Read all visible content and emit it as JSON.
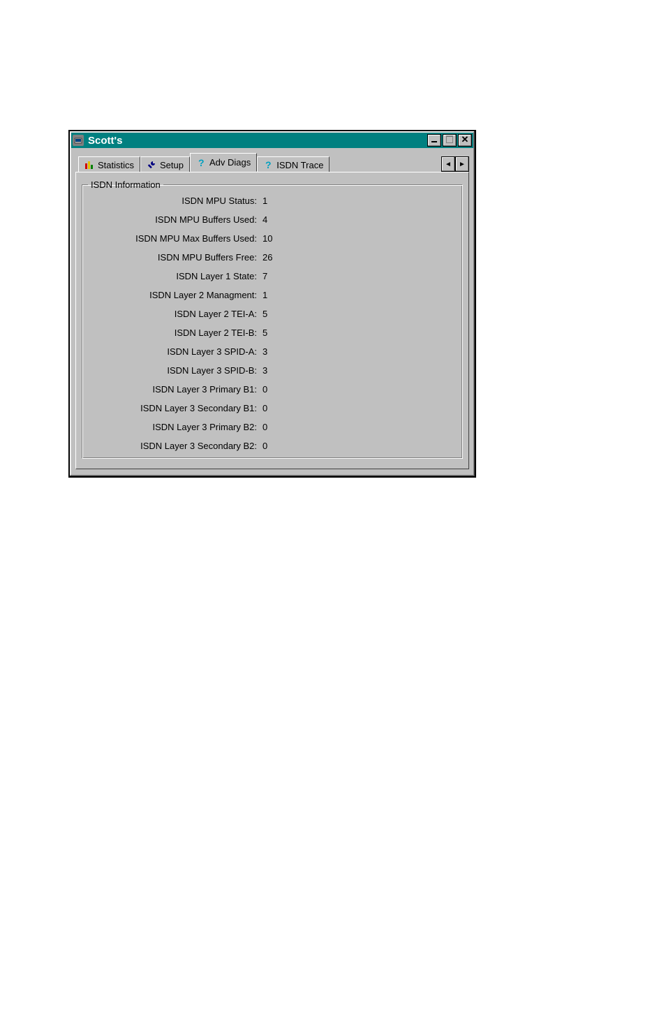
{
  "titlebar": {
    "title": "Scott's"
  },
  "tabs": {
    "items": [
      {
        "label": "Statistics"
      },
      {
        "label": "Setup"
      },
      {
        "label": "Adv Diags"
      },
      {
        "label": "ISDN Trace"
      }
    ],
    "active_index": 2
  },
  "group": {
    "legend": "ISDN Information",
    "rows": [
      {
        "label": "ISDN MPU Status:",
        "value": "1"
      },
      {
        "label": "ISDN MPU Buffers Used:",
        "value": "4"
      },
      {
        "label": "ISDN MPU Max Buffers Used:",
        "value": "10"
      },
      {
        "label": "ISDN MPU Buffers Free:",
        "value": "26"
      },
      {
        "label": "ISDN Layer 1 State:",
        "value": "7"
      },
      {
        "label": "ISDN Layer 2 Managment:",
        "value": "1"
      },
      {
        "label": "ISDN Layer 2 TEI-A:",
        "value": "5"
      },
      {
        "label": "ISDN Layer 2 TEI-B:",
        "value": "5"
      },
      {
        "label": "ISDN Layer 3 SPID-A:",
        "value": "3"
      },
      {
        "label": "ISDN Layer 3 SPID-B:",
        "value": "3"
      },
      {
        "label": "ISDN Layer 3 Primary B1:",
        "value": "0"
      },
      {
        "label": "ISDN Layer 3 Secondary B1:",
        "value": "0"
      },
      {
        "label": "ISDN Layer 3 Primary B2:",
        "value": "0"
      },
      {
        "label": "ISDN Layer 3 Secondary B2:",
        "value": "0"
      }
    ]
  }
}
